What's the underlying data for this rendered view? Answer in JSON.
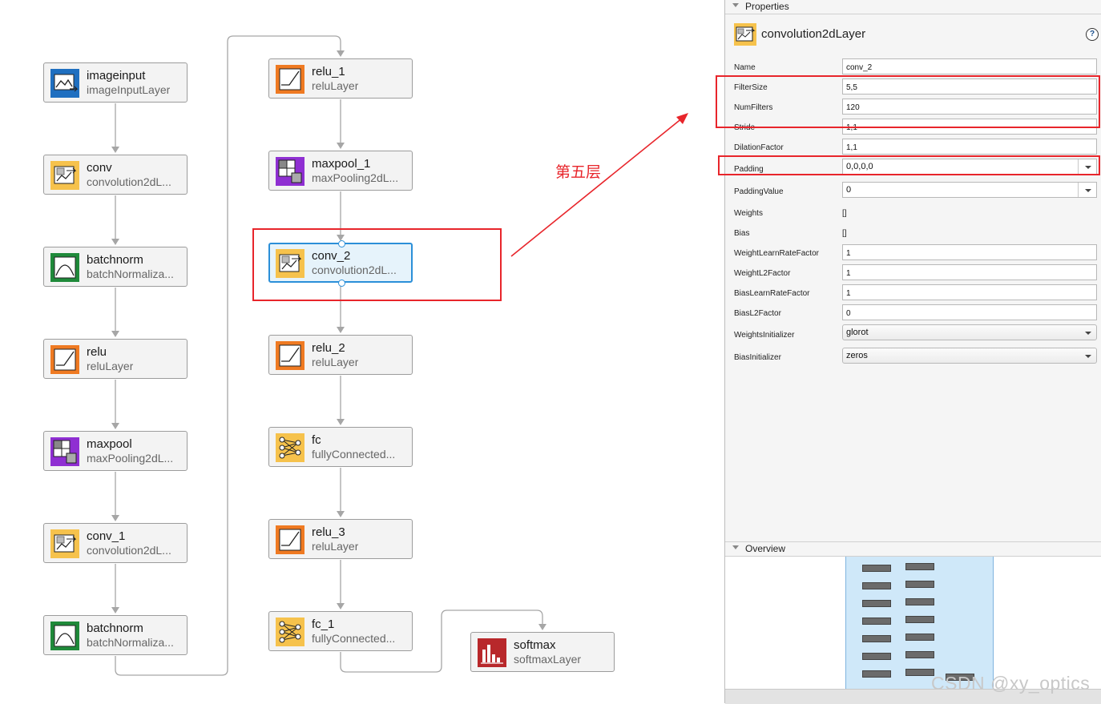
{
  "diagram": {
    "nodes": [
      {
        "name": "imageinput",
        "type": "imageInputLayer",
        "icon": "image-input-icon"
      },
      {
        "name": "conv",
        "type": "convolution2dL...",
        "icon": "convolution-icon"
      },
      {
        "name": "batchnorm",
        "type": "batchNormaliza...",
        "icon": "batchnorm-icon"
      },
      {
        "name": "relu",
        "type": "reluLayer",
        "icon": "relu-icon"
      },
      {
        "name": "maxpool",
        "type": "maxPooling2dL...",
        "icon": "maxpool-icon"
      },
      {
        "name": "conv_1",
        "type": "convolution2dL...",
        "icon": "convolution-icon"
      },
      {
        "name": "batchnorm",
        "type": "batchNormaliza...",
        "icon": "batchnorm-icon"
      },
      {
        "name": "relu_1",
        "type": "reluLayer",
        "icon": "relu-icon"
      },
      {
        "name": "maxpool_1",
        "type": "maxPooling2dL...",
        "icon": "maxpool-icon"
      },
      {
        "name": "conv_2",
        "type": "convolution2dL...",
        "icon": "convolution-icon",
        "selected": true
      },
      {
        "name": "relu_2",
        "type": "reluLayer",
        "icon": "relu-icon"
      },
      {
        "name": "fc",
        "type": "fullyConnected...",
        "icon": "fully-connected-icon"
      },
      {
        "name": "relu_3",
        "type": "reluLayer",
        "icon": "relu-icon"
      },
      {
        "name": "fc_1",
        "type": "fullyConnected...",
        "icon": "fully-connected-icon"
      },
      {
        "name": "softmax",
        "type": "softmaxLayer",
        "icon": "softmax-icon"
      }
    ],
    "annotation": "第五层"
  },
  "properties": {
    "section_title": "Properties",
    "layer_class": "convolution2dLayer",
    "help_label": "?",
    "rows": [
      {
        "label": "Name",
        "value": "conv_2",
        "kind": "field"
      },
      {
        "label": "FilterSize",
        "value": "5,5",
        "kind": "field"
      },
      {
        "label": "NumFilters",
        "value": "120",
        "kind": "field"
      },
      {
        "label": "Stride",
        "value": "1,1",
        "kind": "field"
      },
      {
        "label": "DilationFactor",
        "value": "1,1",
        "kind": "field"
      },
      {
        "label": "Padding",
        "value": "0,0,0,0",
        "kind": "combo"
      },
      {
        "label": "PaddingValue",
        "value": "0",
        "kind": "combo"
      },
      {
        "label": "Weights",
        "value": "[]",
        "kind": "plain"
      },
      {
        "label": "Bias",
        "value": "[]",
        "kind": "plain"
      },
      {
        "label": "WeightLearnRateFactor",
        "value": "1",
        "kind": "field"
      },
      {
        "label": "WeightL2Factor",
        "value": "1",
        "kind": "field"
      },
      {
        "label": "BiasLearnRateFactor",
        "value": "1",
        "kind": "field"
      },
      {
        "label": "BiasL2Factor",
        "value": "0",
        "kind": "field"
      },
      {
        "label": "WeightsInitializer",
        "value": "glorot",
        "kind": "dropdown"
      },
      {
        "label": "BiasInitializer",
        "value": "zeros",
        "kind": "dropdown"
      }
    ]
  },
  "overview": {
    "section_title": "Overview"
  },
  "watermark": "CSDN @xy_optics",
  "colors": {
    "highlight_red": "#e8252b",
    "selection_blue": "#2b8fd8",
    "relu_orange": "#ef7a22",
    "conv_yellow": "#f6c24c",
    "maxpool_purple": "#8f2fd2",
    "batchnorm_green": "#1f8a3a",
    "softmax_red": "#b8282b",
    "input_blue": "#1f6fc0"
  }
}
